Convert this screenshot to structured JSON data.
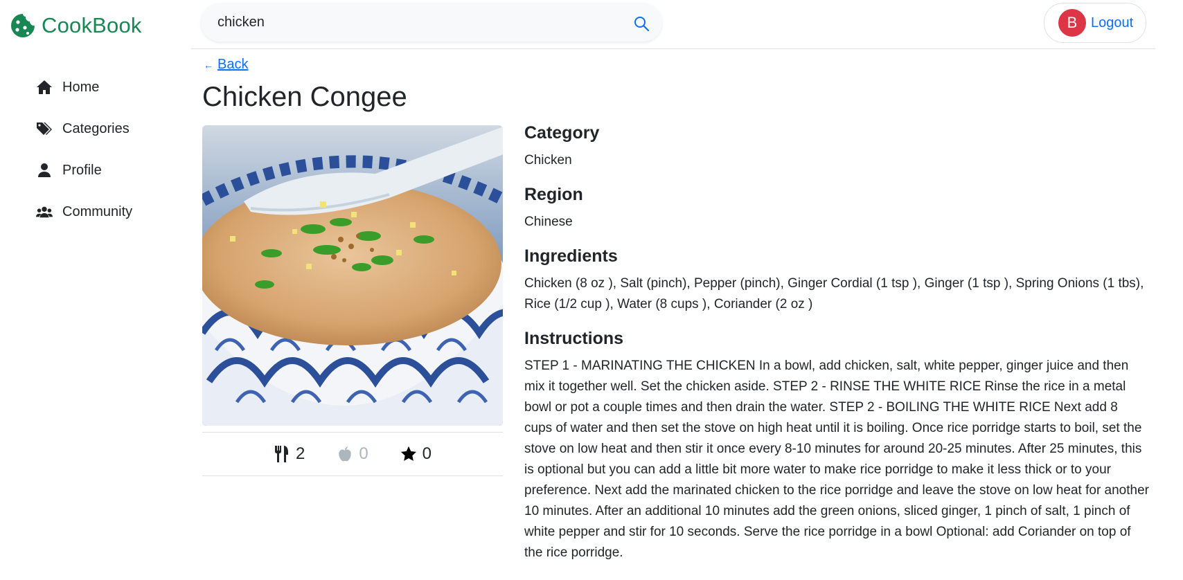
{
  "brand": {
    "name": "CookBook",
    "color": "#198754"
  },
  "sidebar": {
    "items": [
      {
        "label": "Home",
        "icon": "home-icon"
      },
      {
        "label": "Categories",
        "icon": "tags-icon"
      },
      {
        "label": "Profile",
        "icon": "user-icon"
      },
      {
        "label": "Community",
        "icon": "users-icon"
      }
    ]
  },
  "search": {
    "value": "chicken",
    "icon": "search-icon"
  },
  "user": {
    "initial": "B",
    "logout_label": "Logout",
    "avatar_color": "#dc3545"
  },
  "back": {
    "label": "Back"
  },
  "recipe": {
    "title": "Chicken Congee",
    "stats": {
      "cooked": "2",
      "likes": "0",
      "favorites": "0"
    },
    "category_heading": "Category",
    "category": "Chicken",
    "region_heading": "Region",
    "region": "Chinese",
    "ingredients_heading": "Ingredients",
    "ingredients": "Chicken (8 oz ), Salt (pinch), Pepper (pinch), Ginger Cordial (1 tsp ), Ginger (1 tsp ), Spring Onions (1 tbs), Rice (1/2 cup ), Water (8 cups ), Coriander (2 oz )",
    "instructions_heading": "Instructions",
    "instructions": "STEP 1 - MARINATING THE CHICKEN In a bowl, add chicken, salt, white pepper, ginger juice and then mix it together well. Set the chicken aside. STEP 2 - RINSE THE WHITE RICE Rinse the rice in a metal bowl or pot a couple times and then drain the water. STEP 2 - BOILING THE WHITE RICE Next add 8 cups of water and then set the stove on high heat until it is boiling. Once rice porridge starts to boil, set the stove on low heat and then stir it once every 8-10 minutes for around 20-25 minutes. After 25 minutes, this is optional but you can add a little bit more water to make rice porridge to make it less thick or to your preference. Next add the marinated chicken to the rice porridge and leave the stove on low heat for another 10 minutes. After an additional 10 minutes add the green onions, sliced ginger, 1 pinch of salt, 1 pinch of white pepper and stir for 10 seconds. Serve the rice porridge in a bowl Optional: add Coriander on top of the rice porridge."
  }
}
